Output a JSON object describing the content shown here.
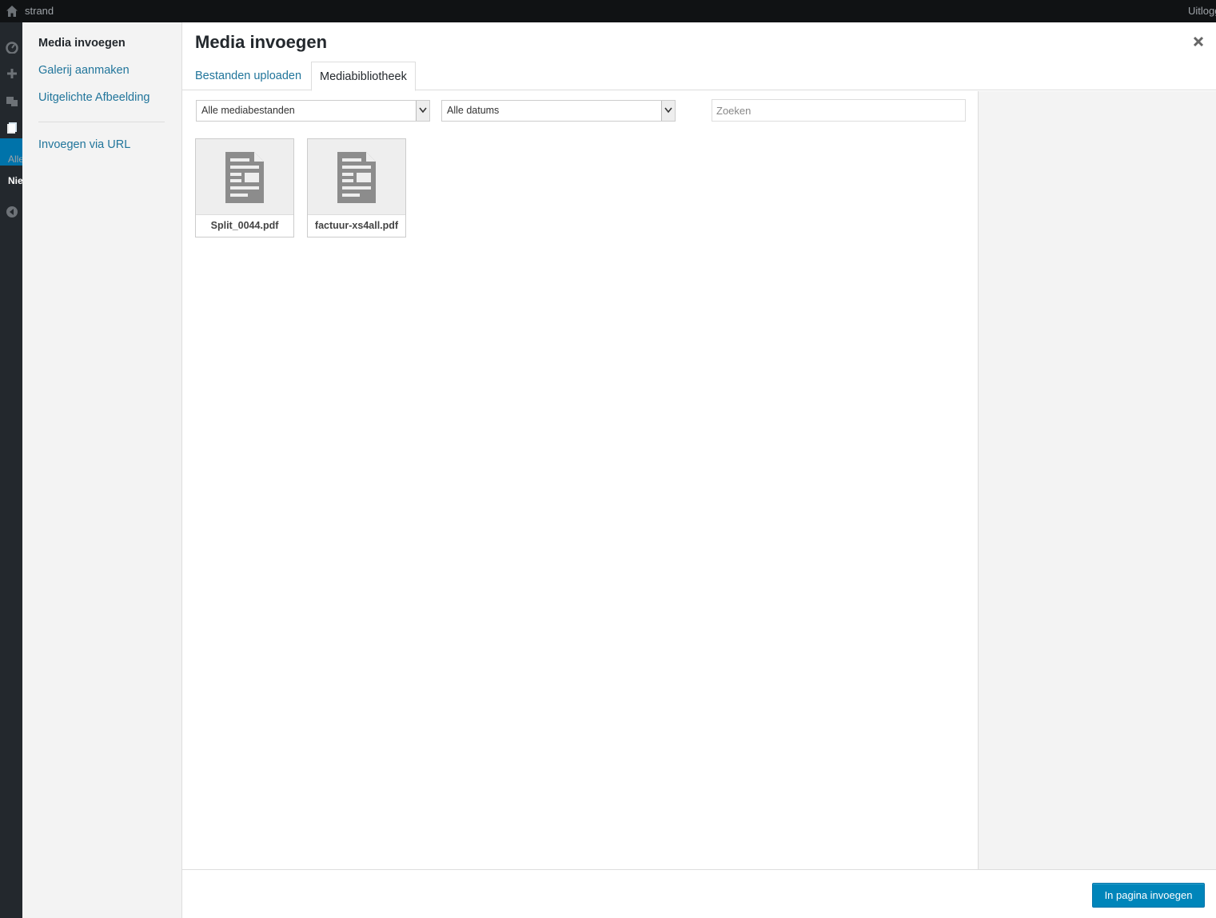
{
  "adminbar": {
    "site_name": "strand",
    "logout_label": "Uitloggen"
  },
  "adminmenu": {
    "sub_items": [
      "Alle",
      "Nieuw"
    ]
  },
  "modal": {
    "menu": {
      "items": [
        {
          "label": "Media invoegen",
          "active": true
        },
        {
          "label": "Galerij aanmaken",
          "active": false
        },
        {
          "label": "Uitgelichte Afbeelding",
          "active": false
        },
        {
          "label": "Invoegen via URL",
          "active": false
        }
      ]
    },
    "title": "Media invoegen",
    "tabs": [
      {
        "label": "Bestanden uploaden",
        "active": false
      },
      {
        "label": "Mediabibliotheek",
        "active": true
      }
    ],
    "filters": {
      "type_selected": "Alle mediabestanden",
      "date_selected": "Alle datums",
      "search_placeholder": "Zoeken"
    },
    "attachments": [
      {
        "filename": "Split_0044.pdf",
        "icon": "document-icon"
      },
      {
        "filename": "factuur-xs4all.pdf",
        "icon": "document-icon"
      }
    ],
    "toolbar": {
      "insert_label": "In pagina invoegen"
    }
  },
  "colors": {
    "link": "#21759b",
    "primary_button": "#0085ba",
    "admin_active": "#0073aa"
  }
}
